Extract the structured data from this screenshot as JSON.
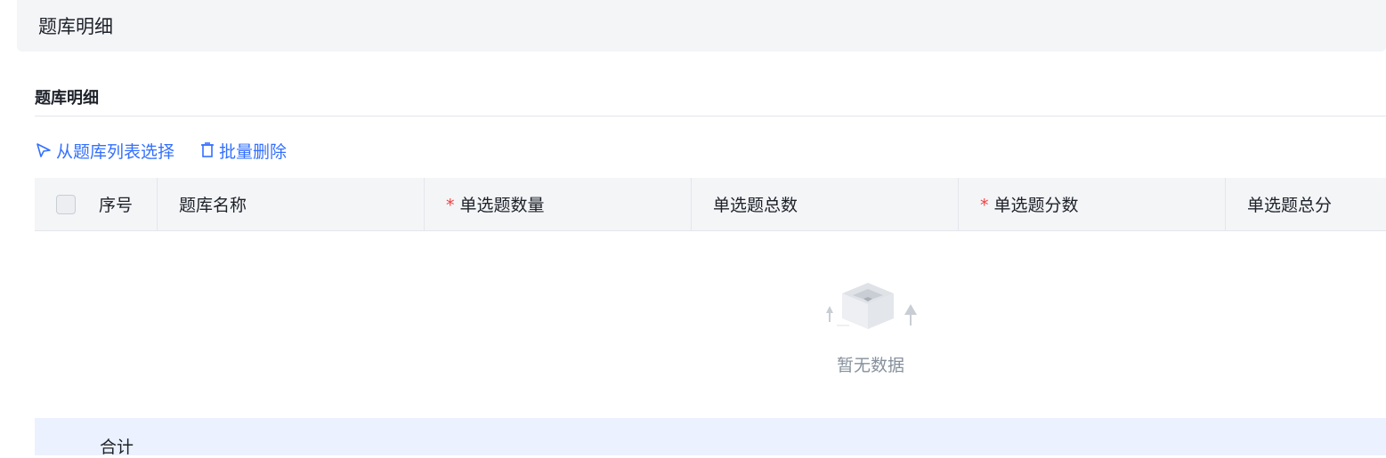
{
  "page_header": {
    "title": "题库明细"
  },
  "section": {
    "title": "题库明细"
  },
  "toolbar": {
    "select_from_list": "从题库列表选择",
    "batch_delete": "批量删除"
  },
  "table": {
    "columns": [
      {
        "label": "序号",
        "required": false
      },
      {
        "label": "题库名称",
        "required": false
      },
      {
        "label": "单选题数量",
        "required": true
      },
      {
        "label": "单选题总数",
        "required": false
      },
      {
        "label": "单选题分数",
        "required": true
      },
      {
        "label": "单选题总分",
        "required": false
      }
    ],
    "required_mark": "*",
    "empty_text": "暂无数据"
  },
  "summary": {
    "label": "合计"
  },
  "colors": {
    "accent": "#3370ff",
    "required": "#f53f3f",
    "header_bg": "#f4f5f7",
    "summary_bg": "#ebf1fe"
  }
}
